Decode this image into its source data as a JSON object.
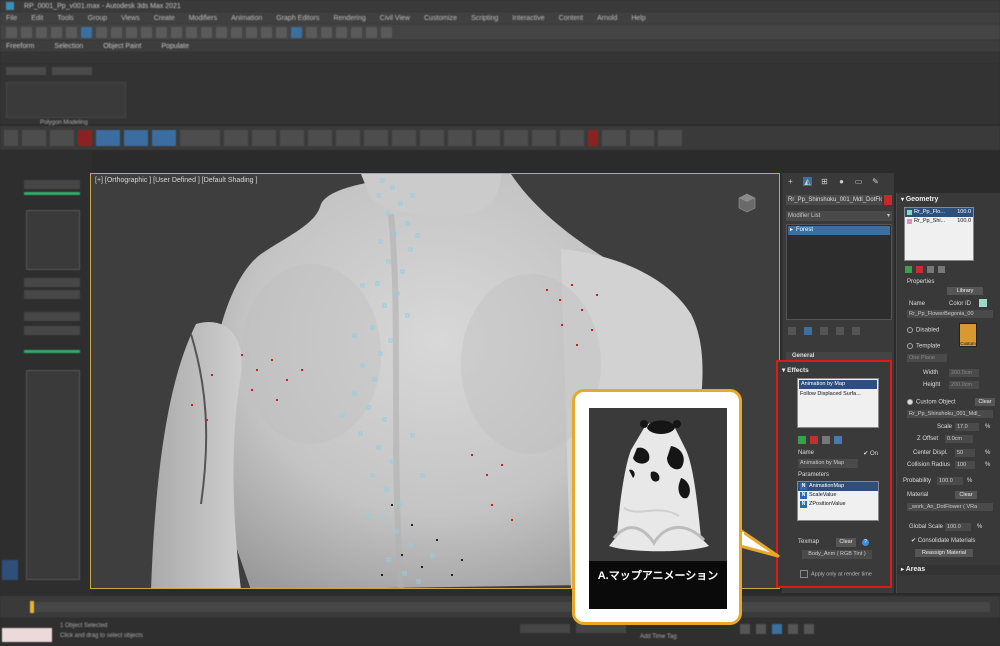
{
  "window": {
    "title": "RP_0001_Pp_v001.max - Autodesk 3ds Max 2021"
  },
  "menubar": {
    "items": [
      "File",
      "Edit",
      "Tools",
      "Group",
      "Views",
      "Create",
      "Modifiers",
      "Animation",
      "Graph Editors",
      "Rendering",
      "Civil View",
      "Customize",
      "Scripting",
      "Interactive",
      "Content",
      "Arnold",
      "Help"
    ]
  },
  "toolbar2": {
    "items": [
      "Freeform",
      "Selection",
      "Object Paint",
      "Populate"
    ]
  },
  "ribbon": {
    "label": "Polygon Modeling"
  },
  "viewport": {
    "label": "[+] [Orthographic ] [User Defined ] [Default Shading ]"
  },
  "command_panel": {
    "object_name": "Rr_Pp_Shinshoku_001_Mdl_DotFlo",
    "object_color": "#c82828",
    "modifier_list_label": "Modifier List",
    "modifier_stack": [
      "Forest"
    ],
    "general_rollout": "General"
  },
  "effects": {
    "title": "Effects",
    "list": [
      "Animation by Map",
      "Follow Displaced Surfa..."
    ],
    "selected_index": 0,
    "name_label": "Name",
    "on_label": "On",
    "name_value": "Animation by Map",
    "parameters_label": "Parameters",
    "parameters": [
      "AnimationMap",
      "ScaleValue",
      "ZPositionValue"
    ],
    "texmap_label": "Texmap",
    "clear_label": "Clear",
    "texmap_value": "Body_Anm ( RGB Tint )",
    "apply_label": "Apply only at render time"
  },
  "geometry": {
    "title": "Geometry",
    "items": [
      {
        "name": "Rr_Pp_Flo...",
        "pct": "100.0",
        "color": "#88e0a0"
      },
      {
        "name": "Rr_Pp_Shi...",
        "pct": "100.0",
        "color": "#e090c0"
      }
    ],
    "properties_label": "Properties",
    "library_label": "Library",
    "name_label": "Name",
    "color_id_label": "Color ID",
    "name_value": "Rr_Pp_FlowerBegonia_00",
    "disabled_label": "Disabled",
    "template_label": "Template",
    "template_value": "One Plane",
    "width_label": "Width",
    "width_value": "200.0cm",
    "height_label": "Height",
    "height_value": "200.0cm",
    "custom_object_label": "Custom Object",
    "custom_clear_label": "Clear",
    "custom_object_value": "Rr_Pp_Shinshoku_001_Mdl_",
    "scale_label": "Scale",
    "scale_value": "17.0",
    "z_offset_label": "Z Offset",
    "z_offset_value": "0.0cm",
    "center_displ_label": "Center Displ.",
    "center_displ_value": "50",
    "collision_radius_label": "Collision Radius",
    "collision_radius_value": "100",
    "probability_label": "Probability",
    "probability_value": "100.0",
    "material_label": "Material",
    "material_clear_label": "Clear",
    "material_value": "_work_An_DotFlower ( VRa",
    "global_scale_label": "Global Scale",
    "global_scale_value": "100.0",
    "consolidate_label": "Consolidate Materials",
    "reassign_label": "Reassign Material",
    "custom_thumb_label": "Custom",
    "pct_symbol": "%",
    "areas_label": "Areas"
  },
  "statusbar": {
    "selection_text": "1 Object Selected",
    "hint_text": "Click and drag to select objects",
    "add_time_tag": "Add Time Tag"
  },
  "callout": {
    "caption": "A.マップアニメーション",
    "border_color": "#e8a92a"
  }
}
